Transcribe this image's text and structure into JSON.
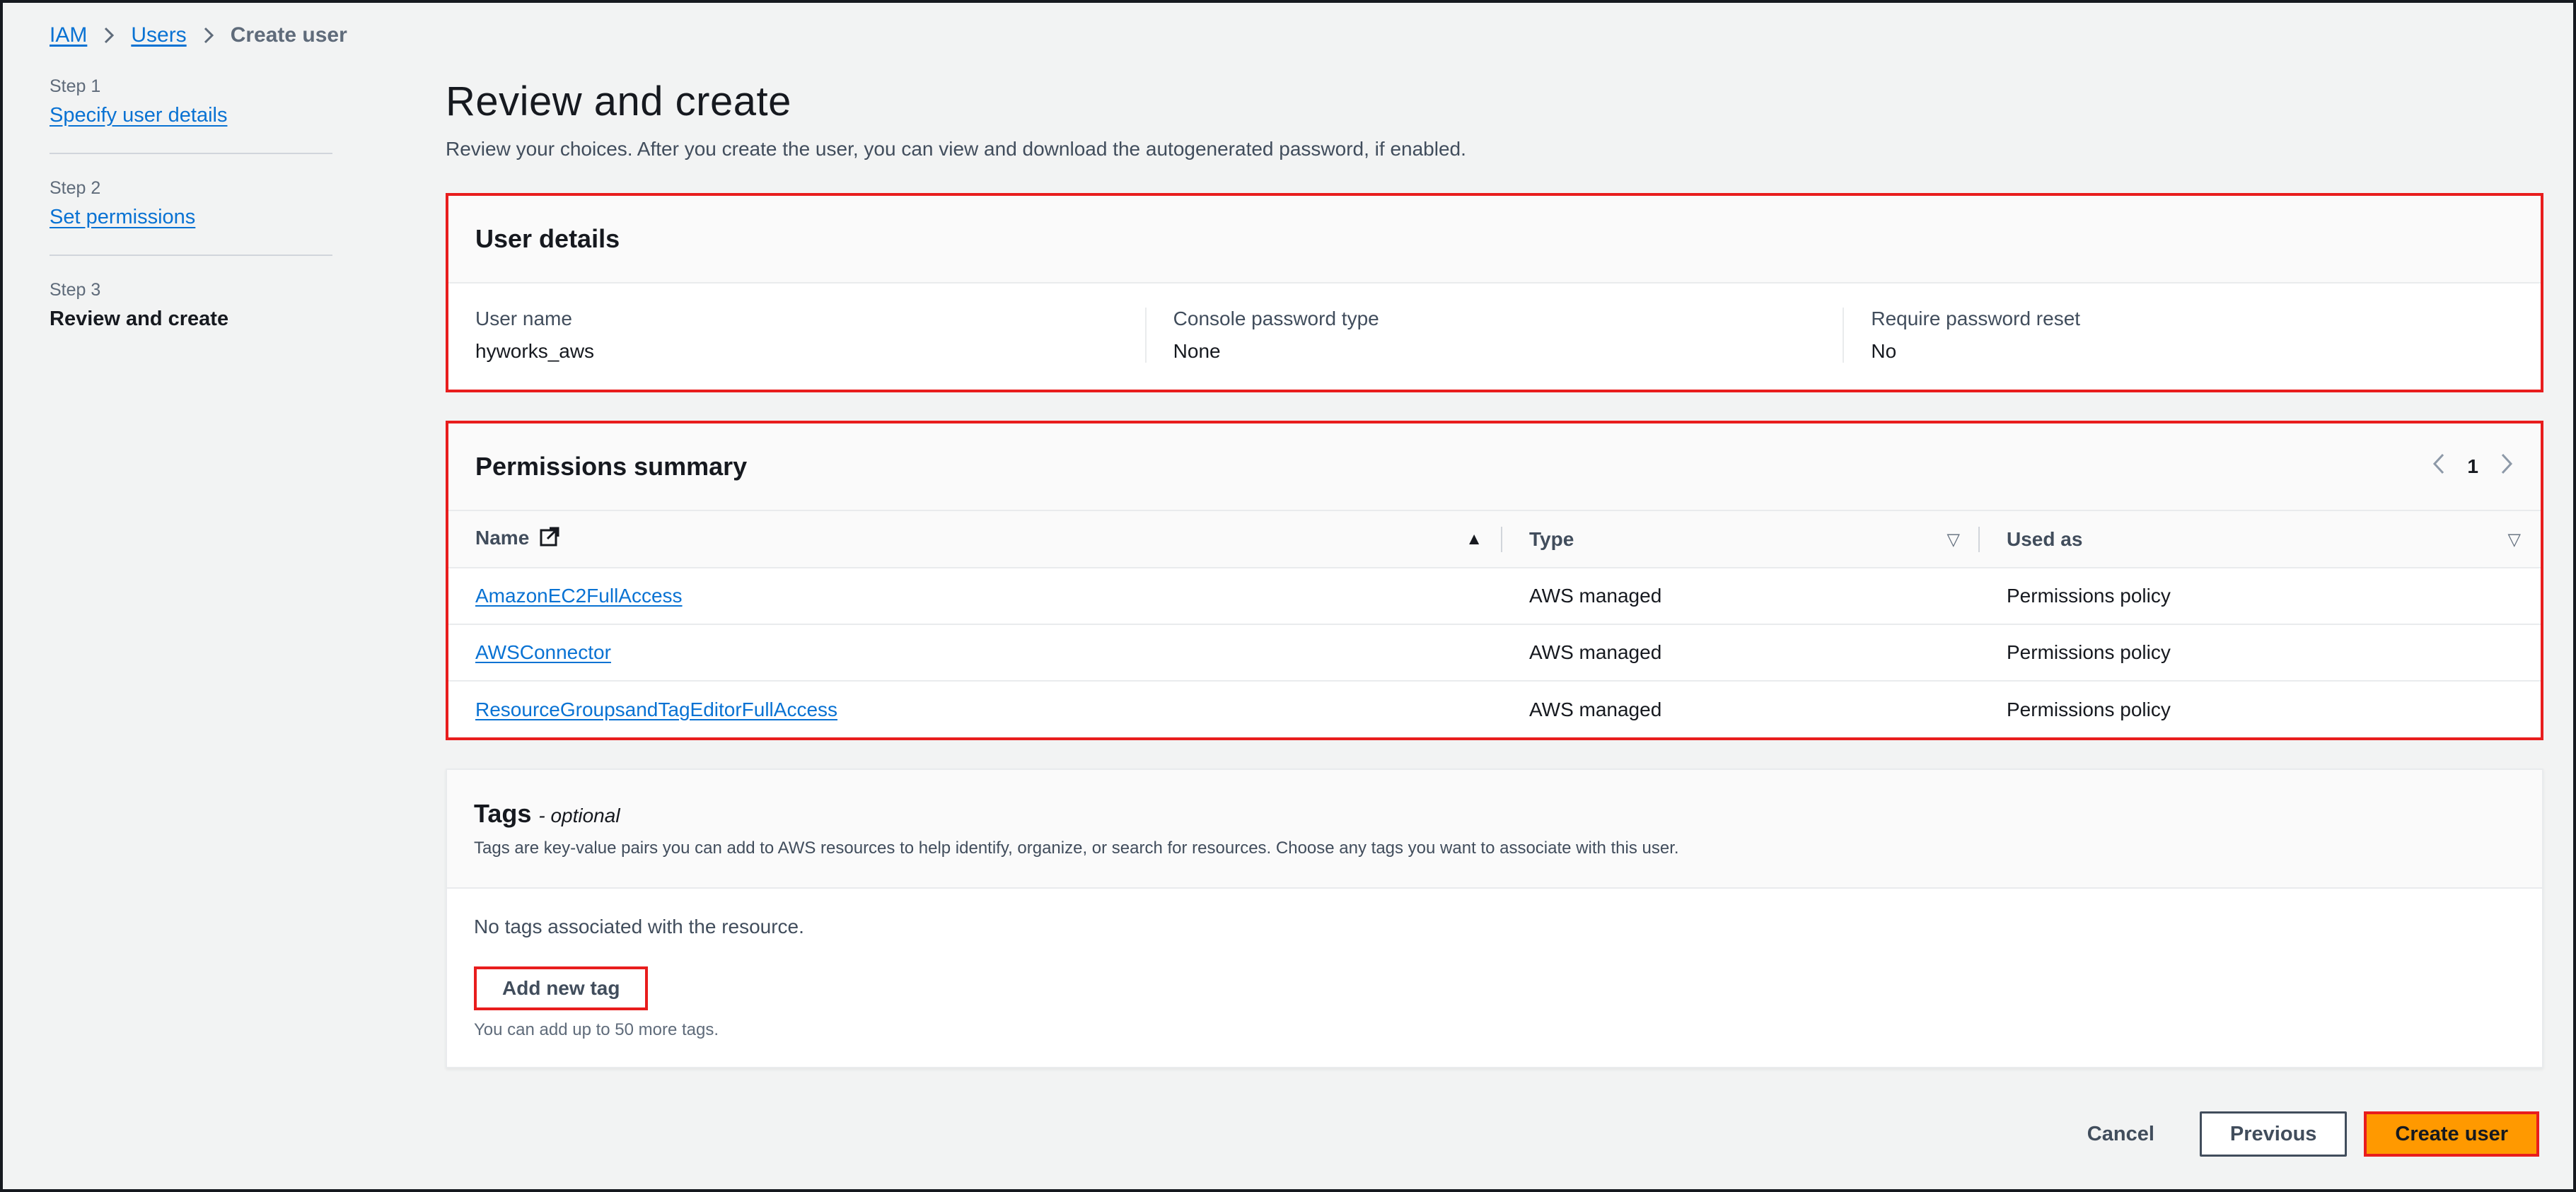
{
  "breadcrumb": {
    "iam": "IAM",
    "users": "Users",
    "current": "Create user"
  },
  "steps": [
    {
      "label": "Step 1",
      "title": "Specify user details"
    },
    {
      "label": "Step 2",
      "title": "Set permissions"
    },
    {
      "label": "Step 3",
      "title": "Review and create"
    }
  ],
  "page": {
    "title": "Review and create",
    "description": "Review your choices. After you create the user, you can view and download the autogenerated password, if enabled."
  },
  "user_details": {
    "title": "User details",
    "fields": [
      {
        "label": "User name",
        "value": "hyworks_aws"
      },
      {
        "label": "Console password type",
        "value": "None"
      },
      {
        "label": "Require password reset",
        "value": "No"
      }
    ]
  },
  "permissions": {
    "title": "Permissions summary",
    "page_number": "1",
    "columns": [
      "Name",
      "Type",
      "Used as"
    ],
    "rows": [
      {
        "name": "AmazonEC2FullAccess",
        "type": "AWS managed",
        "used_as": "Permissions policy"
      },
      {
        "name": "AWSConnector",
        "type": "AWS managed",
        "used_as": "Permissions policy"
      },
      {
        "name": "ResourceGroupsandTagEditorFullAccess",
        "type": "AWS managed",
        "used_as": "Permissions policy"
      }
    ]
  },
  "tags": {
    "title": "Tags",
    "optional": "- optional",
    "description": "Tags are key-value pairs you can add to AWS resources to help identify, organize, or search for resources. Choose any tags you want to associate with this user.",
    "empty": "No tags associated with the resource.",
    "add_button": "Add new tag",
    "hint": "You can add up to 50 more tags."
  },
  "footer": {
    "cancel": "Cancel",
    "previous": "Previous",
    "create": "Create user"
  },
  "colors": {
    "link": "#0972d3",
    "primary": "#ff9900",
    "highlight": "#e81d1d"
  }
}
